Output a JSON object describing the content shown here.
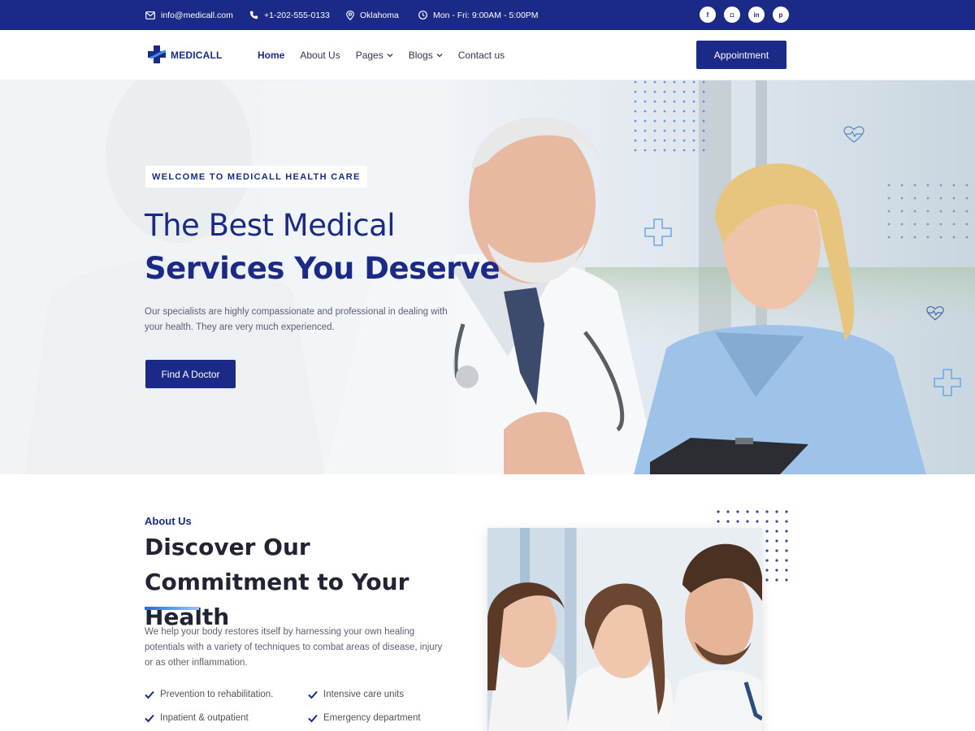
{
  "topbar": {
    "email": "info@medicall.com",
    "phone": "+1-202-555-0133",
    "location": "Oklahoma",
    "hours": "Mon - Fri: 9:00AM - 5:00PM",
    "socials": [
      {
        "icon": "facebook-icon",
        "glyph": "f"
      },
      {
        "icon": "instagram-icon",
        "glyph": "◘"
      },
      {
        "icon": "linkedin-icon",
        "glyph": "in"
      },
      {
        "icon": "pinterest-icon",
        "glyph": "p"
      }
    ]
  },
  "nav": {
    "logo": "MEDICALL",
    "items": [
      "Home",
      "About Us",
      "Pages",
      "Blogs",
      "Contact us"
    ],
    "cta": "Appointment"
  },
  "hero": {
    "badge": "WELCOME TO MEDICALL HEALTH CARE",
    "title_line1": "The Best Medical",
    "title_line2": "Services You Deserve",
    "description": "Our specialists are highly compassionate and professional in dealing with your health. They are very much experienced.",
    "button": "Find A Doctor"
  },
  "about": {
    "kicker": "About Us",
    "title": "Discover Our Commitment to Your Health",
    "description": "We help your body restores itself by harnessing your own healing potentials with a variety of techniques to combat areas of disease, injury or as other inflammation.",
    "features": [
      "Prevention to rehabilitation.",
      "Intensive care units",
      "Inpatient & outpatient",
      "Emergency department"
    ]
  },
  "colors": {
    "brand": "#1a2a86",
    "accent": "#1c6fe0"
  }
}
